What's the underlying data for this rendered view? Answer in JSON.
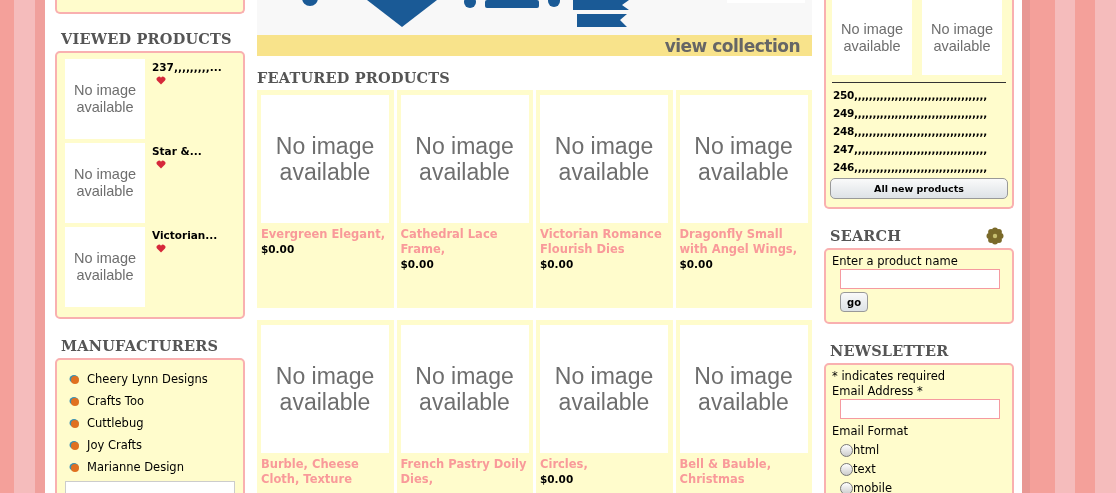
{
  "left": {
    "viewed_products": {
      "title": "VIEWED PRODUCTS",
      "items": [
        {
          "image_text": "No image available",
          "name": "237,,,,,,,,,..."
        },
        {
          "image_text": "No image available",
          "name": "Star &..."
        },
        {
          "image_text": "No image available",
          "name": "Victorian..."
        }
      ]
    },
    "manufacturers": {
      "title": "MANUFACTURERS",
      "items": [
        "Cheery Lynn Designs",
        "Crafts Too",
        "Cuttlebug",
        "Joy Crafts",
        "Marianne Design"
      ]
    }
  },
  "banner": {
    "link": "view collection"
  },
  "featured": {
    "title": "FEATURED PRODUCTS",
    "rows": [
      [
        {
          "image_text": "No image available",
          "name": "Evergreen Elegant,",
          "price": "$0.00"
        },
        {
          "image_text": "No image available",
          "name": "Cathedral Lace Frame,",
          "price": "$0.00"
        },
        {
          "image_text": "No image available",
          "name": "Victorian Romance Flourish Dies",
          "price": "$0.00"
        },
        {
          "image_text": "No image available",
          "name": "Dragonfly Small with Angel Wings,",
          "price": "$0.00"
        }
      ],
      [
        {
          "image_text": "No image available",
          "name": "Burble, Cheese Cloth, Texture"
        },
        {
          "image_text": "No image available",
          "name": "French Pastry Doily Dies,"
        },
        {
          "image_text": "No image available",
          "name": "Circles,",
          "price": "$0.00"
        },
        {
          "image_text": "No image available",
          "name": "Bell & Bauble, Christmas"
        }
      ]
    ]
  },
  "right": {
    "new_products": {
      "images": [
        "No image available",
        "No image available"
      ],
      "items": [
        "250,,,,,,,,,,,,,,,,,,,,,,,,,,,,,,,,,,,,",
        "249,,,,,,,,,,,,,,,,,,,,,,,,,,,,,,,,,,,,",
        "248,,,,,,,,,,,,,,,,,,,,,,,,,,,,,,,,,,,,",
        "247,,,,,,,,,,,,,,,,,,,,,,,,,,,,,,,,,,,,",
        "246,,,,,,,,,,,,,,,,,,,,,,,,,,,,,,,,,,,,"
      ],
      "button": "All new products"
    },
    "search": {
      "title": "SEARCH",
      "label": "Enter a product name",
      "button": "go"
    },
    "newsletter": {
      "title": "NEWSLETTER",
      "note": "* indicates required",
      "email_label": "Email Address *",
      "format_label": "Email Format",
      "options": [
        {
          "label": "html",
          "selected": false
        },
        {
          "label": "text",
          "selected": false
        },
        {
          "label": "mobile",
          "selected": false
        }
      ]
    }
  }
}
